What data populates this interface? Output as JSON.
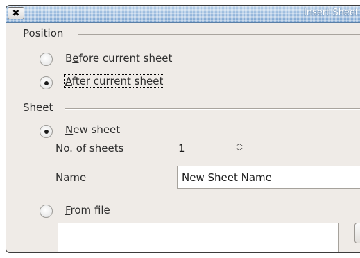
{
  "window": {
    "title": "Insert Sheet",
    "close_glyph": "✕"
  },
  "position": {
    "group_label": "Position",
    "before_prefix": "B",
    "before_underline": "e",
    "before_rest": "fore current sheet",
    "before_checked": false,
    "after_underline": "A",
    "after_rest": "fter current sheet",
    "after_checked": true
  },
  "sheet": {
    "group_label": "Sheet",
    "new_underline": "N",
    "new_rest": "ew sheet",
    "new_checked": true,
    "num_prefix": "N",
    "num_underline": "o",
    "num_rest": ". of sheets",
    "num_value": "1",
    "name_prefix": "Na",
    "name_underline": "m",
    "name_rest": "e",
    "name_value": "New Sheet Name",
    "from_underline": "F",
    "from_rest": "rom file",
    "from_checked": false
  },
  "icons": {
    "close": "close-icon",
    "spin_up": "chevron-up-icon",
    "spin_down": "chevron-down-icon"
  }
}
